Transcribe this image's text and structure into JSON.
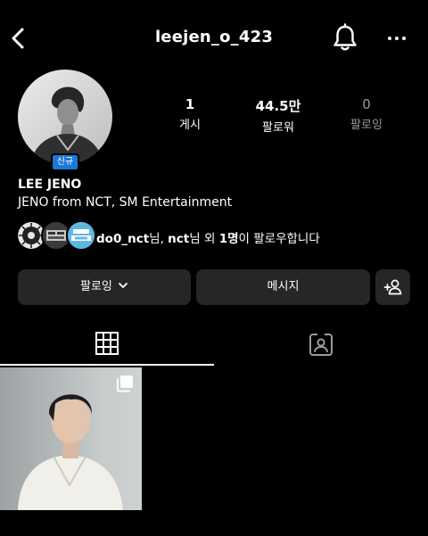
{
  "header": {
    "username": "leejen_o_423",
    "icons": [
      "back-chevron-icon",
      "bell-icon",
      "more-dots-icon"
    ]
  },
  "profile": {
    "badge": "신규",
    "display_name": "LEE JENO",
    "bio": "JENO from NCT, SM Entertainment"
  },
  "stats": {
    "posts": {
      "value": "1",
      "label": "게시"
    },
    "followers": {
      "value": "44.5만",
      "label": "팔로워"
    },
    "following": {
      "value": "0",
      "label": "팔로잉"
    }
  },
  "followed_by": {
    "user1": "do0_nct",
    "mid1": "님, ",
    "user2": "nct",
    "mid2": "님 외 ",
    "count": "1명",
    "tail": "이 팔로우합니다"
  },
  "actions": {
    "following_label": "팔로잉",
    "message_label": "메시지"
  },
  "tabs": {
    "active": "grid",
    "icons": [
      "grid-icon",
      "tagged-icon"
    ]
  },
  "colors": {
    "background": "#000000",
    "button": "#262626",
    "badge": "#1c78d6",
    "dim_text": "#9a9a9a"
  }
}
